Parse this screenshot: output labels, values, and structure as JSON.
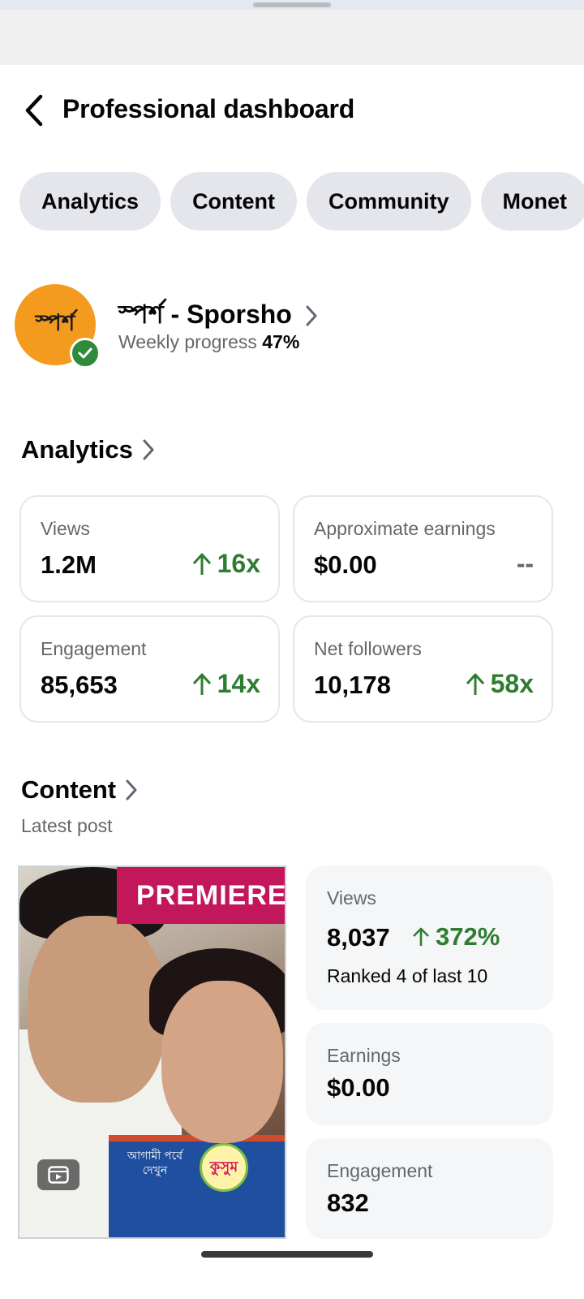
{
  "header": {
    "title": "Professional dashboard"
  },
  "tabs": [
    {
      "label": "Analytics"
    },
    {
      "label": "Content"
    },
    {
      "label": "Community"
    },
    {
      "label": "Monet"
    }
  ],
  "profile": {
    "avatar_text": "স্পর্শ",
    "page_name": "স্পর্শ - Sporsho",
    "weekly_label": "Weekly progress",
    "weekly_value": "47%",
    "verified": true
  },
  "analytics": {
    "title": "Analytics",
    "cards": [
      {
        "label": "Views",
        "value": "1.2M",
        "delta": "16x"
      },
      {
        "label": "Approximate earnings",
        "value": "$0.00",
        "delta": "--"
      },
      {
        "label": "Engagement",
        "value": "85,653",
        "delta": "14x"
      },
      {
        "label": "Net followers",
        "value": "10,178",
        "delta": "58x"
      }
    ]
  },
  "content": {
    "title": "Content",
    "subtitle": "Latest post",
    "post": {
      "badge": "PREMIERE",
      "overlay_text_1": "আগামী পর্বে",
      "overlay_text_2": "দেখুন",
      "logo_text": "কুসুম"
    },
    "stats": {
      "views_label": "Views",
      "views_value": "8,037",
      "views_delta": "372%",
      "ranked": "Ranked 4 of last 10",
      "earnings_label": "Earnings",
      "earnings_value": "$0.00",
      "engagement_label": "Engagement",
      "engagement_value": "832"
    }
  },
  "colors": {
    "positive": "#2e7d32",
    "muted": "#65676b",
    "tab_bg": "#e4e6eb",
    "avatar_bg": "#f39a1f",
    "premiere_bg": "#c2185b"
  }
}
